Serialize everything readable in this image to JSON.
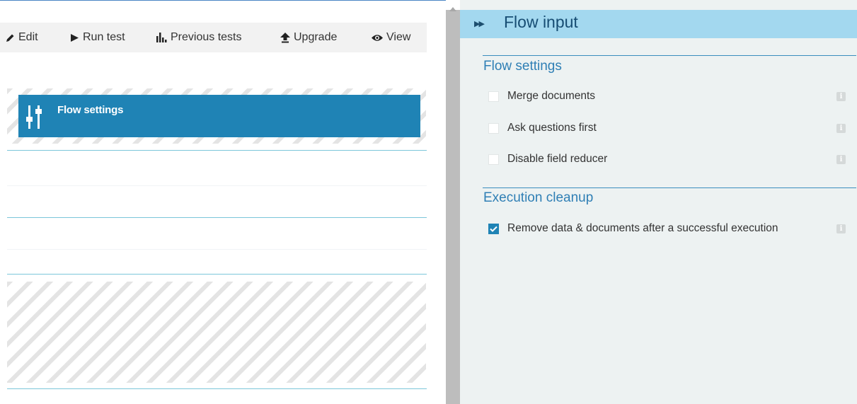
{
  "toolbar": {
    "items": [
      {
        "label": "Edit",
        "icon": "pencil-icon"
      },
      {
        "label": "Run test",
        "icon": "play-icon"
      },
      {
        "label": "Previous tests",
        "icon": "bar-chart-icon"
      },
      {
        "label": "Upgrade",
        "icon": "upgrade-arrow-icon"
      },
      {
        "label": "View",
        "icon": "eye-icon"
      }
    ]
  },
  "canvas": {
    "block_label": "Flow settings",
    "block_icon": "sliders-icon",
    "block_color": "#1f83b5"
  },
  "panel": {
    "title": "Flow input",
    "toggle_icon": "double-chevron-right-icon",
    "header_color": "#a3d8ef",
    "sections": [
      {
        "title": "Flow settings",
        "options": [
          {
            "label": "Merge documents",
            "checked": false
          },
          {
            "label": "Ask questions first",
            "checked": false
          },
          {
            "label": "Disable field reducer",
            "checked": false
          }
        ]
      },
      {
        "title": "Execution cleanup",
        "options": [
          {
            "label": "Remove data & documents after a successful execution",
            "checked": true
          }
        ]
      }
    ],
    "info_icon": "info-icon"
  },
  "colors": {
    "accent": "#1f83b5",
    "section_title": "#2f7fb5",
    "panel_bg": "#edf2f2"
  }
}
